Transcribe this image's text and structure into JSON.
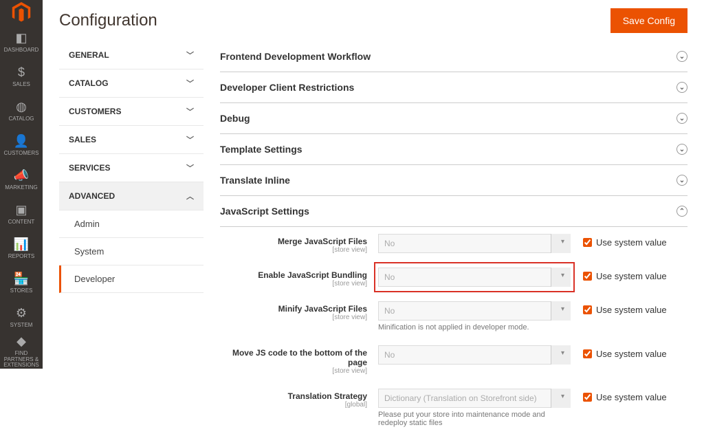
{
  "page": {
    "title": "Configuration",
    "save_label": "Save Config"
  },
  "nav": {
    "items": [
      {
        "label": "DASHBOARD",
        "icon": "◧"
      },
      {
        "label": "SALES",
        "icon": "$"
      },
      {
        "label": "CATALOG",
        "icon": "◍"
      },
      {
        "label": "CUSTOMERS",
        "icon": "👤"
      },
      {
        "label": "MARKETING",
        "icon": "📣"
      },
      {
        "label": "CONTENT",
        "icon": "▣"
      },
      {
        "label": "REPORTS",
        "icon": "📊"
      },
      {
        "label": "STORES",
        "icon": "🏪"
      },
      {
        "label": "SYSTEM",
        "icon": "⚙"
      },
      {
        "label": "FIND PARTNERS & EXTENSIONS",
        "icon": "◆"
      }
    ]
  },
  "config_sidebar": {
    "sections": [
      {
        "label": "GENERAL",
        "expanded": false
      },
      {
        "label": "CATALOG",
        "expanded": false
      },
      {
        "label": "CUSTOMERS",
        "expanded": false
      },
      {
        "label": "SALES",
        "expanded": false
      },
      {
        "label": "SERVICES",
        "expanded": false
      },
      {
        "label": "ADVANCED",
        "expanded": true,
        "children": [
          {
            "label": "Admin",
            "active": false
          },
          {
            "label": "System",
            "active": false
          },
          {
            "label": "Developer",
            "active": true
          }
        ]
      }
    ]
  },
  "fieldsets": [
    {
      "label": "Frontend Development Workflow",
      "expanded": false
    },
    {
      "label": "Developer Client Restrictions",
      "expanded": false
    },
    {
      "label": "Debug",
      "expanded": false
    },
    {
      "label": "Template Settings",
      "expanded": false
    },
    {
      "label": "Translate Inline",
      "expanded": false
    },
    {
      "label": "JavaScript Settings",
      "expanded": true
    }
  ],
  "js_settings": {
    "fields": [
      {
        "label": "Merge JavaScript Files",
        "scope": "[store view]",
        "value": "No",
        "use_system": true,
        "use_system_label": "Use system value"
      },
      {
        "label": "Enable JavaScript Bundling",
        "scope": "[store view]",
        "value": "No",
        "use_system": true,
        "use_system_label": "Use system value",
        "highlight": true
      },
      {
        "label": "Minify JavaScript Files",
        "scope": "[store view]",
        "value": "No",
        "use_system": true,
        "use_system_label": "Use system value",
        "note": "Minification is not applied in developer mode."
      },
      {
        "label": "Move JS code to the bottom of the page",
        "scope": "[store view]",
        "value": "No",
        "use_system": true,
        "use_system_label": "Use system value"
      },
      {
        "label": "Translation Strategy",
        "scope": "[global]",
        "value": "Dictionary (Translation on Storefront side)",
        "use_system": true,
        "use_system_label": "Use system value",
        "note": "Please put your store into maintenance mode and redeploy static files"
      }
    ]
  }
}
